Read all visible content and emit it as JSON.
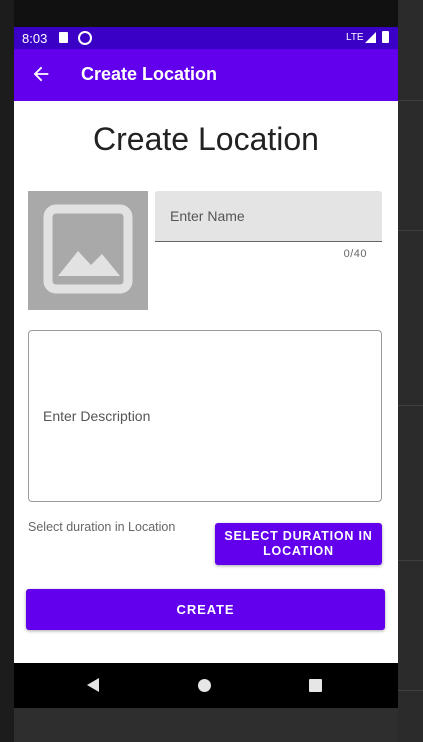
{
  "status_bar": {
    "time": "8:03",
    "network": "LTE",
    "icons": [
      "sd-card-icon",
      "sync-icon",
      "signal-icon",
      "battery-icon"
    ]
  },
  "app_bar": {
    "title": "Create Location",
    "back_icon": "arrow-back-icon"
  },
  "form": {
    "heading": "Create Location",
    "image_placeholder_icon": "image-icon",
    "name": {
      "placeholder": "Enter Name",
      "value": "",
      "counter": "0/40"
    },
    "description": {
      "placeholder": "Enter Description",
      "value": ""
    },
    "duration_label": "Select duration in Location",
    "duration_button": "SELECT DURATION IN LOCATION",
    "create_button": "CREATE"
  },
  "nav_bar": {
    "icons": [
      "nav-back-icon",
      "nav-home-icon",
      "nav-recents-icon"
    ]
  },
  "colors": {
    "primary": "#6200ee",
    "primary_dark": "#3700b3",
    "placeholder_gray": "#a9a9a9"
  }
}
